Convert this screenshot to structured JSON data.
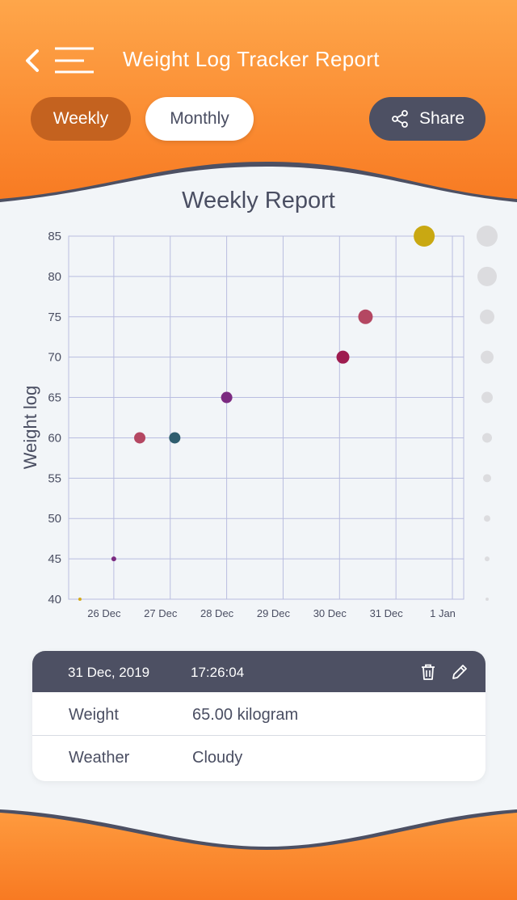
{
  "header": {
    "title": "Weight Log Tracker Report",
    "back_icon": "chevron-left-icon",
    "menu_icon": "hamburger-menu-icon"
  },
  "tabs": {
    "weekly_label": "Weekly",
    "monthly_label": "Monthly",
    "selected": "Weekly"
  },
  "share": {
    "label": "Share",
    "icon": "share-icon"
  },
  "colors": {
    "header_orange": "#f98a2a",
    "weekly_pill": "#c4621f",
    "dark_slate": "#4d5063",
    "background": "#f2f5f8",
    "grid_line": "#b9bde0"
  },
  "chart_data": {
    "type": "scatter",
    "title": "Weekly Report",
    "ylabel": "Weight log",
    "xlabel": "",
    "y_ticks": [
      40,
      45,
      50,
      55,
      60,
      65,
      70,
      75,
      80,
      85
    ],
    "ylim": [
      40,
      85
    ],
    "x_ticks": [
      "26 Dec",
      "27 Dec",
      "28 Dec",
      "29 Dec",
      "30 Dec",
      "31 Dec",
      "1 Jan"
    ],
    "x_range_days": [
      -0.8,
      6.2
    ],
    "grid": true,
    "points": [
      {
        "x": "25 Dec 08:00",
        "y": 40,
        "color": "#d4a91a",
        "size": 2
      },
      {
        "x": "26 Dec",
        "y": 45,
        "color": "#7a2a80",
        "size": 3
      },
      {
        "x": "26 Dec 11:00",
        "y": 60,
        "color": "#b44762",
        "size": 7
      },
      {
        "x": "27 Dec 02:00",
        "y": 60,
        "color": "#2f5d6e",
        "size": 7
      },
      {
        "x": "28 Dec",
        "y": 65,
        "color": "#7b2a80",
        "size": 7
      },
      {
        "x": "30 Dec 02:00",
        "y": 70,
        "color": "#9e1c4f",
        "size": 8
      },
      {
        "x": "30 Dec 11:00",
        "y": 75,
        "color": "#b44762",
        "size": 9
      },
      {
        "x": "31 Dec 12:00",
        "y": 85,
        "color": "#c9a812",
        "size": 13
      }
    ],
    "x_values_days": [
      -0.6,
      0,
      0.46,
      1.08,
      2.0,
      4.06,
      4.46,
      5.5
    ],
    "size_legend": [
      13,
      12,
      9,
      8,
      7,
      6,
      5,
      4,
      3,
      2
    ]
  },
  "entry": {
    "date": "31 Dec, 2019",
    "time": "17:26:04",
    "delete_icon": "trash-icon",
    "edit_icon": "pencil-icon",
    "rows": [
      {
        "label": "Weight",
        "value": "65.00 kilogram"
      },
      {
        "label": "Weather",
        "value": "Cloudy"
      }
    ]
  }
}
